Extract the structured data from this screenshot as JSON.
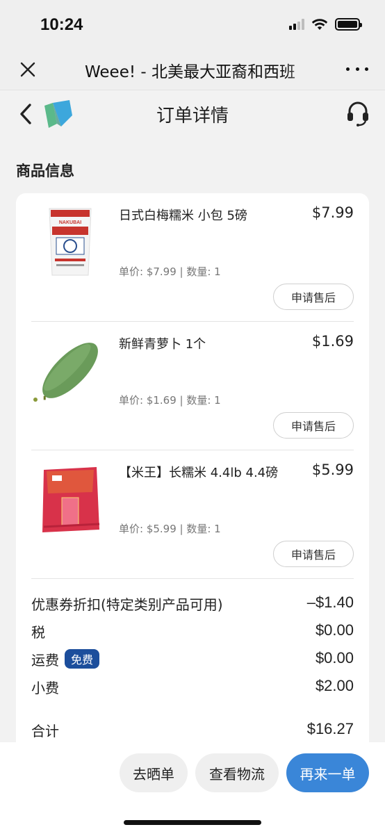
{
  "status_bar": {
    "time": "10:24"
  },
  "browser": {
    "title": "Weee! - 北美最大亚裔和西班"
  },
  "header": {
    "title": "订单详情"
  },
  "section_title": "商品信息",
  "items": [
    {
      "name": "日式白梅糯米 小包 5磅",
      "price": "$7.99",
      "meta": "单价: $7.99 | 数量: 1",
      "action": "申请售后",
      "image": "rice-bag-white"
    },
    {
      "name": "新鲜青萝卜 1个",
      "price": "$1.69",
      "meta": "单价: $1.69 | 数量: 1",
      "action": "申请售后",
      "image": "green-radish"
    },
    {
      "name": "【米王】长糯米 4.4lb 4.4磅",
      "price": "$5.99",
      "meta": "单价: $5.99 | 数量: 1",
      "action": "申请售后",
      "image": "rice-bag-red"
    }
  ],
  "summary": {
    "coupon_label": "优惠券折扣(特定类别产品可用)",
    "coupon_value": "–$1.40",
    "tax_label": "税",
    "tax_value": "$0.00",
    "shipping_label": "运费",
    "shipping_badge": "免费",
    "shipping_value": "$0.00",
    "tip_label": "小费",
    "tip_value": "$2.00",
    "total_label": "合计",
    "total_value": "$16.27"
  },
  "actions": {
    "review": "去晒单",
    "tracking": "查看物流",
    "reorder": "再来一单"
  },
  "colors": {
    "accent": "#3a86d8",
    "badge": "#1c4e9c"
  }
}
